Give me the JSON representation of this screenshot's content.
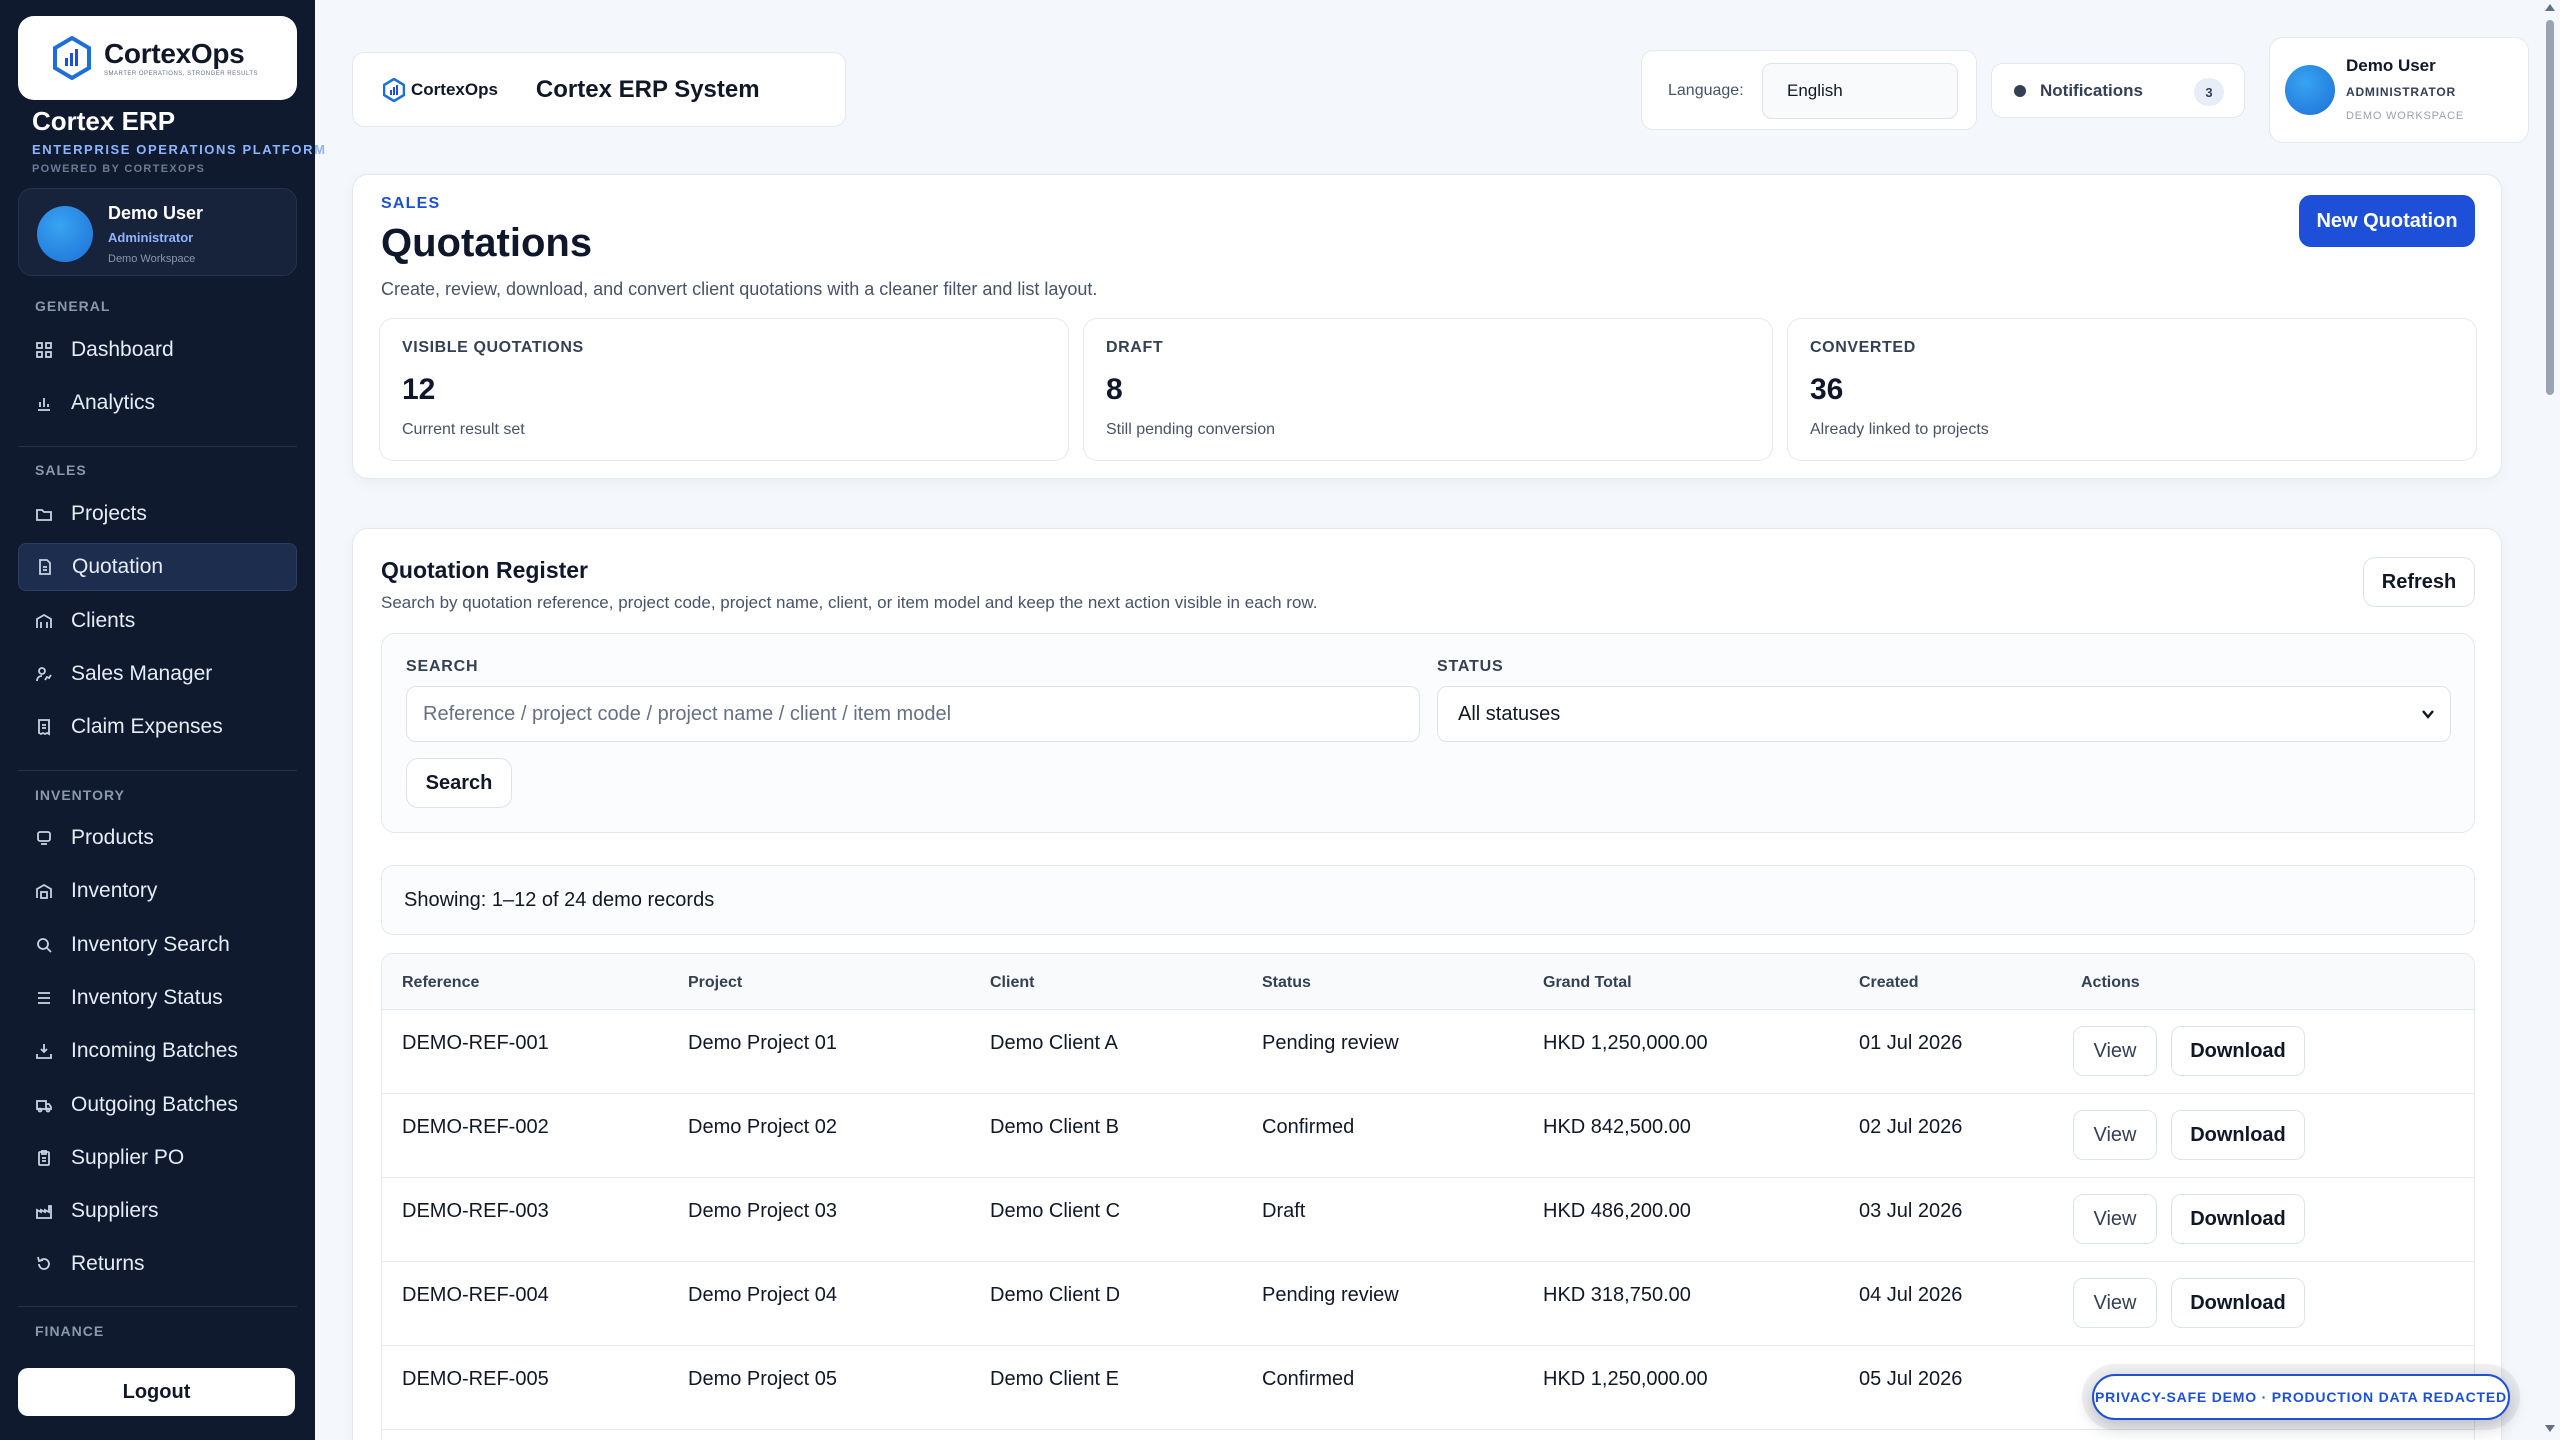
{
  "sidebar": {
    "brand_name": "CortexOps",
    "brand_tagline": "SMARTER OPERATIONS, STRONGER RESULTS",
    "app_title": "Cortex ERP",
    "app_subtitle": "ENTERPRISE OPERATIONS PLATFORM",
    "powered_by": "POWERED BY CORTEXOPS",
    "user": {
      "name": "Demo User",
      "role": "Administrator",
      "workspace": "Demo Workspace"
    },
    "sections": {
      "general": "GENERAL",
      "sales": "SALES",
      "inventory": "INVENTORY",
      "finance": "FINANCE"
    },
    "items": {
      "dashboard": "Dashboard",
      "analytics": "Analytics",
      "projects": "Projects",
      "quotation": "Quotation",
      "clients": "Clients",
      "sales_manager": "Sales Manager",
      "claim_expenses": "Claim Expenses",
      "products": "Products",
      "inventory": "Inventory",
      "inventory_search": "Inventory Search",
      "inventory_status": "Inventory Status",
      "incoming_batches": "Incoming Batches",
      "outgoing_batches": "Outgoing Batches",
      "supplier_po": "Supplier PO",
      "suppliers": "Suppliers",
      "returns": "Returns"
    },
    "logout": "Logout"
  },
  "header": {
    "brand_name": "CortexOps",
    "system_title": "Cortex ERP System",
    "language_label": "Language:",
    "language_value": "English",
    "notifications_label": "Notifications",
    "notifications_count": "3",
    "user": {
      "name": "Demo User",
      "role": "ADMINISTRATOR",
      "workspace": "DEMO WORKSPACE"
    }
  },
  "summary": {
    "eyebrow": "SALES",
    "title": "Quotations",
    "description": "Create, review, download, and convert client quotations with a cleaner filter and list layout.",
    "new_button": "New Quotation",
    "stats": [
      {
        "label": "VISIBLE QUOTATIONS",
        "value": "12",
        "hint": "Current result set"
      },
      {
        "label": "DRAFT",
        "value": "8",
        "hint": "Still pending conversion"
      },
      {
        "label": "CONVERTED",
        "value": "36",
        "hint": "Already linked to projects"
      }
    ]
  },
  "register": {
    "title": "Quotation Register",
    "description": "Search by quotation reference, project code, project name, client, or item model and keep the next action visible in each row.",
    "refresh": "Refresh",
    "search_label": "SEARCH",
    "search_placeholder": "Reference / project code / project name / client / item model",
    "status_label": "STATUS",
    "status_value": "All statuses",
    "search_button": "Search",
    "showing": "Showing: 1–12 of 24 demo records",
    "columns": [
      "Reference",
      "Project",
      "Client",
      "Status",
      "Grand Total",
      "Created",
      "Actions"
    ],
    "view_label": "View",
    "download_label": "Download",
    "rows": [
      {
        "reference": "DEMO-REF-001",
        "project": "Demo Project 01",
        "client": "Demo Client A",
        "status": "Pending review",
        "total": "HKD 1,250,000.00",
        "created": "01 Jul 2026"
      },
      {
        "reference": "DEMO-REF-002",
        "project": "Demo Project 02",
        "client": "Demo Client B",
        "status": "Confirmed",
        "total": "HKD 842,500.00",
        "created": "02 Jul 2026"
      },
      {
        "reference": "DEMO-REF-003",
        "project": "Demo Project 03",
        "client": "Demo Client C",
        "status": "Draft",
        "total": "HKD 486,200.00",
        "created": "03 Jul 2026"
      },
      {
        "reference": "DEMO-REF-004",
        "project": "Demo Project 04",
        "client": "Demo Client D",
        "status": "Pending review",
        "total": "HKD 318,750.00",
        "created": "04 Jul 2026"
      },
      {
        "reference": "DEMO-REF-005",
        "project": "Demo Project 05",
        "client": "Demo Client E",
        "status": "Confirmed",
        "total": "HKD 1,250,000.00",
        "created": "05 Jul 2026"
      }
    ]
  },
  "privacy_badge": "PRIVACY-SAFE DEMO · PRODUCTION DATA REDACTED",
  "colors": {
    "sidebar_bg": "#0f1a2e",
    "accent": "#1d4fd8",
    "page_bg": "#f4f7fb"
  }
}
